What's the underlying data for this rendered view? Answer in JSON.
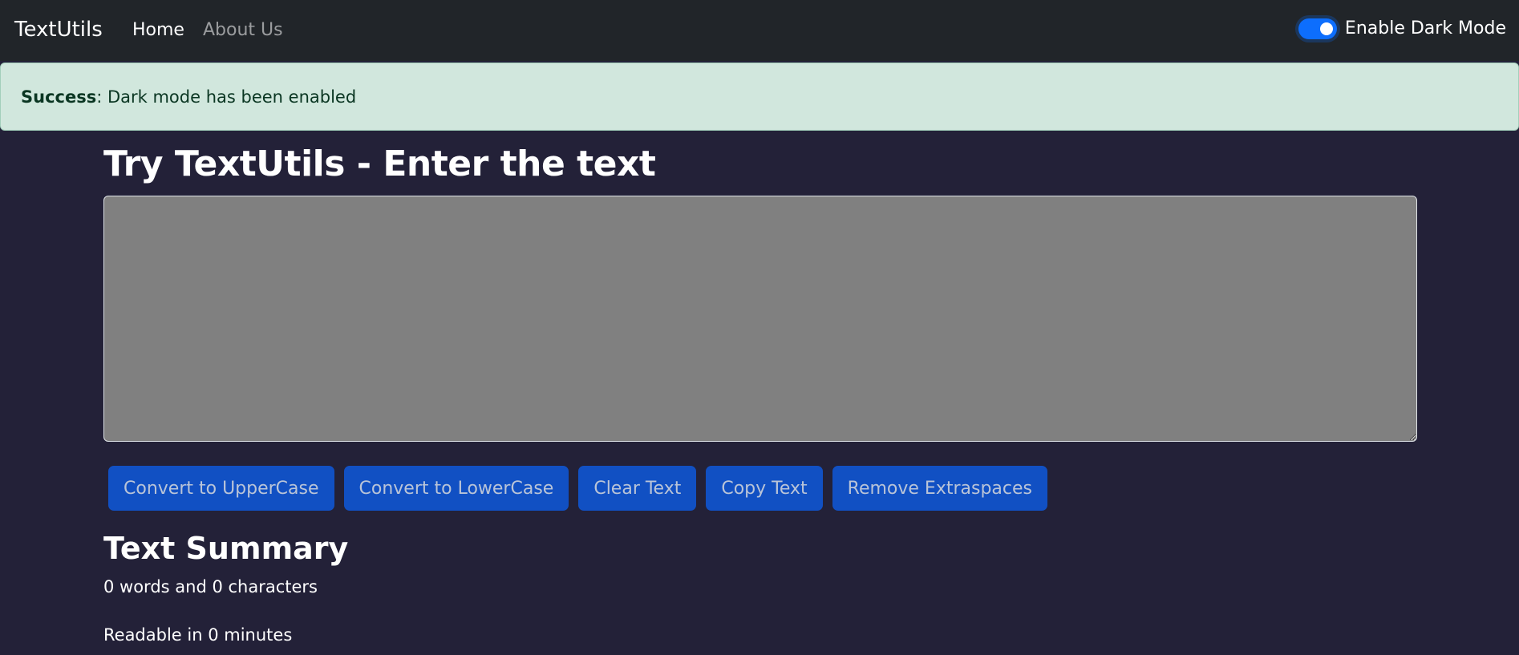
{
  "navbar": {
    "brand": "TextUtils",
    "links": [
      {
        "label": "Home",
        "active": true
      },
      {
        "label": "About Us",
        "active": false
      }
    ],
    "dark_mode_toggle": {
      "label": "Enable Dark Mode",
      "checked": true
    }
  },
  "alert": {
    "type": "Success",
    "message": ": Dark mode has been enabled"
  },
  "main": {
    "heading": "Try TextUtils - Enter the text",
    "textarea": {
      "value": "",
      "placeholder": ""
    },
    "buttons": [
      "Convert to UpperCase",
      "Convert to LowerCase",
      "Clear Text",
      "Copy Text",
      "Remove Extraspaces"
    ]
  },
  "summary": {
    "title": "Text Summary",
    "counts": "0 words and 0 characters",
    "readable": "Readable in 0 minutes"
  },
  "colors": {
    "navbar_bg": "#212529",
    "page_bg": "#232138",
    "alert_bg": "#d1e7dd",
    "button_bg": "#1150c3",
    "textarea_bg": "#808080",
    "toggle_accent": "#0d6efd"
  }
}
